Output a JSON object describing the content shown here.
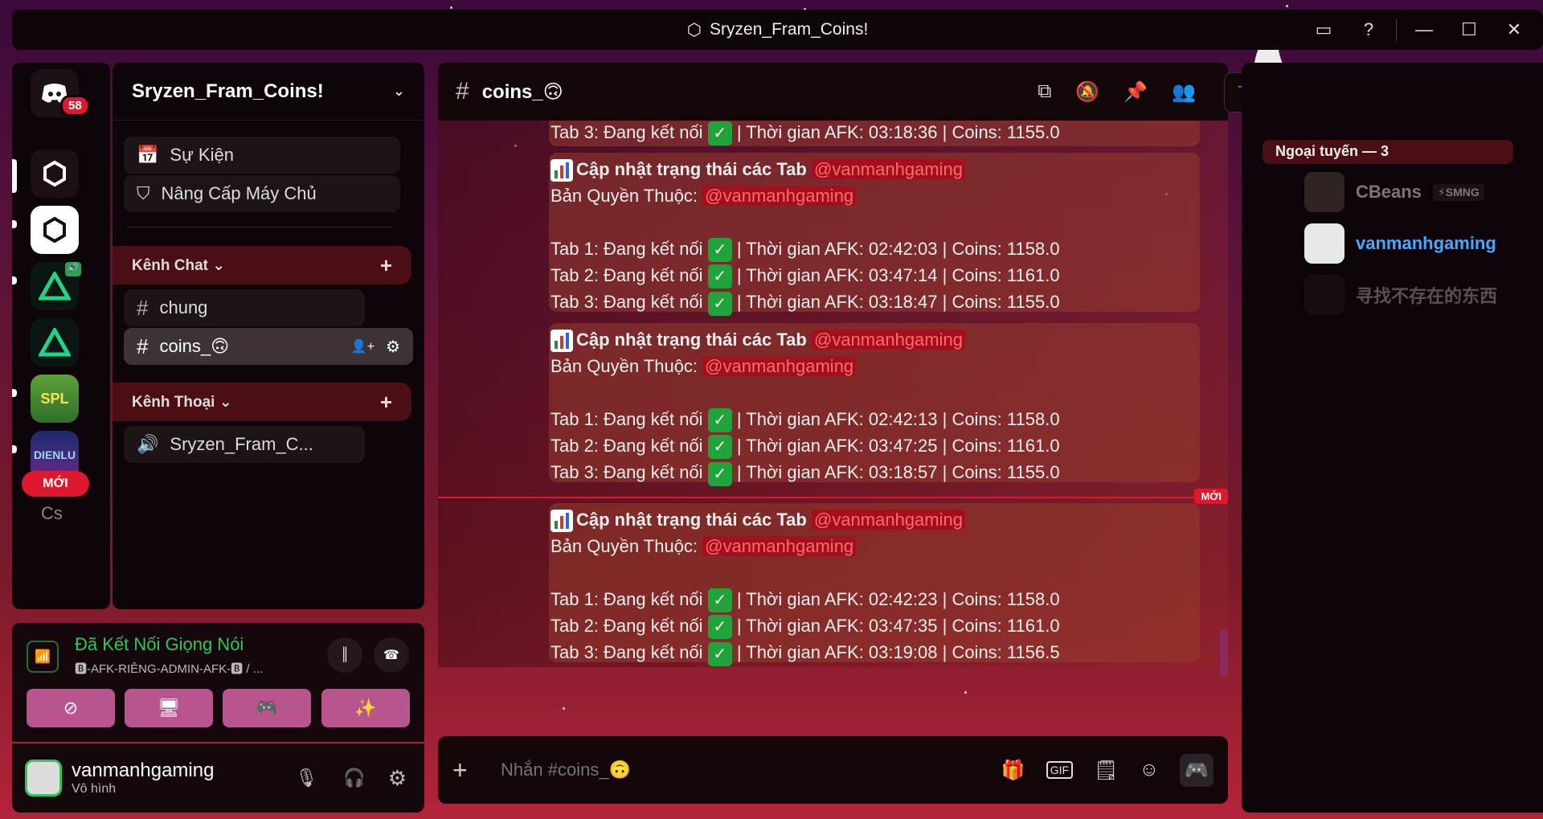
{
  "window": {
    "title": "Sryzen_Fram_Coins!"
  },
  "rail": {
    "badge_count": "58",
    "new_label": "MỚI",
    "partial_label": "Cs"
  },
  "server": {
    "name": "Sryzen_Fram_Coins!",
    "events_label": "Sự Kiện",
    "boost_label": "Nâng Cấp Máy Chủ",
    "categories": [
      {
        "name": "Kênh Chat",
        "channels": [
          "chung",
          "coins_🙃"
        ]
      },
      {
        "name": "Kênh Thoại",
        "channels": [
          "Sryzen_Fram_C..."
        ]
      }
    ]
  },
  "voice": {
    "status": "Đã Kết Nối Giọng Nói",
    "channel": "🅱-AFK-RIÊNG-ADMIN-AFK-🅱 / ..."
  },
  "user": {
    "name": "vanmanhgaming",
    "status": "Vô hình"
  },
  "channel": {
    "name": "coins_🙃"
  },
  "search": {
    "placeholder": "Tìm kiếm"
  },
  "composer": {
    "placeholder": "Nhắn #coins_🙃"
  },
  "messages": {
    "partial_line": {
      "tab": "Tab 3: Đang kết nối",
      "rest": "| Thời gian AFK: 03:18:36 | Coins: 1155.0"
    },
    "title": "Cập nhật trạng thái các Tab",
    "mention": "@vanmanhgaming",
    "copyright": "Bản Quyền Thuộc:",
    "new_label": "MỚI",
    "items": [
      {
        "tabs": [
          {
            "label": "Tab 1: Đang kết nối",
            "rest": "| Thời gian AFK: 02:42:03 | Coins: 1158.0"
          },
          {
            "label": "Tab 2: Đang kết nối",
            "rest": "| Thời gian AFK: 03:47:14 | Coins: 1161.0"
          },
          {
            "label": "Tab 3: Đang kết nối",
            "rest": "| Thời gian AFK: 03:18:47 | Coins: 1155.0"
          }
        ]
      },
      {
        "tabs": [
          {
            "label": "Tab 1: Đang kết nối",
            "rest": "| Thời gian AFK: 02:42:13 | Coins: 1158.0"
          },
          {
            "label": "Tab 2: Đang kết nối",
            "rest": "| Thời gian AFK: 03:47:25 | Coins: 1161.0"
          },
          {
            "label": "Tab 3: Đang kết nối",
            "rest": "| Thời gian AFK: 03:18:57 | Coins: 1155.0"
          }
        ]
      },
      {
        "tabs": [
          {
            "label": "Tab 1: Đang kết nối",
            "rest": "| Thời gian AFK: 02:42:23 | Coins: 1158.0"
          },
          {
            "label": "Tab 2: Đang kết nối",
            "rest": "| Thời gian AFK: 03:47:35 | Coins: 1161.0"
          },
          {
            "label": "Tab 3: Đang kết nối",
            "rest": "| Thời gian AFK: 03:19:08 | Coins: 1156.5"
          }
        ]
      }
    ]
  },
  "members": {
    "section": "Ngoại tuyến — 3",
    "list": [
      {
        "name": "CBeans",
        "tag": "⚡SMNG"
      },
      {
        "name": "vanmanhgaming"
      },
      {
        "name": "寻找不存在的东西"
      }
    ]
  }
}
